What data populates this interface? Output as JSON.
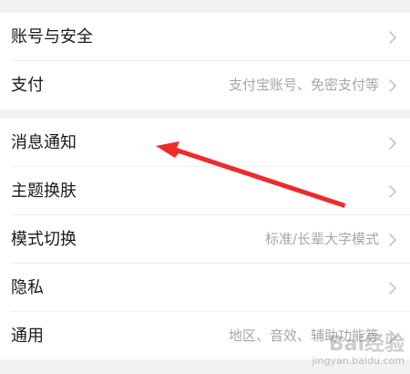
{
  "settings": {
    "group1": [
      {
        "label": "账号与安全",
        "hint": ""
      },
      {
        "label": "支付",
        "hint": "支付宝账号、免密支付等"
      }
    ],
    "group2": [
      {
        "label": "消息通知",
        "hint": ""
      },
      {
        "label": "主题换肤",
        "hint": ""
      },
      {
        "label": "模式切换",
        "hint": "标准/长辈大字模式"
      },
      {
        "label": "隐私",
        "hint": ""
      },
      {
        "label": "通用",
        "hint": "地区、音效、辅助功能等"
      }
    ]
  },
  "annotation": {
    "arrow_color": "#ee2b2b"
  },
  "watermark": {
    "text": "jingyan.baidu.com"
  },
  "colors": {
    "background": "#f2f2f2",
    "card": "#ffffff",
    "title_text": "#1a1a1a",
    "hint_text": "#a6a6a6",
    "chevron": "#c4c4c4"
  }
}
